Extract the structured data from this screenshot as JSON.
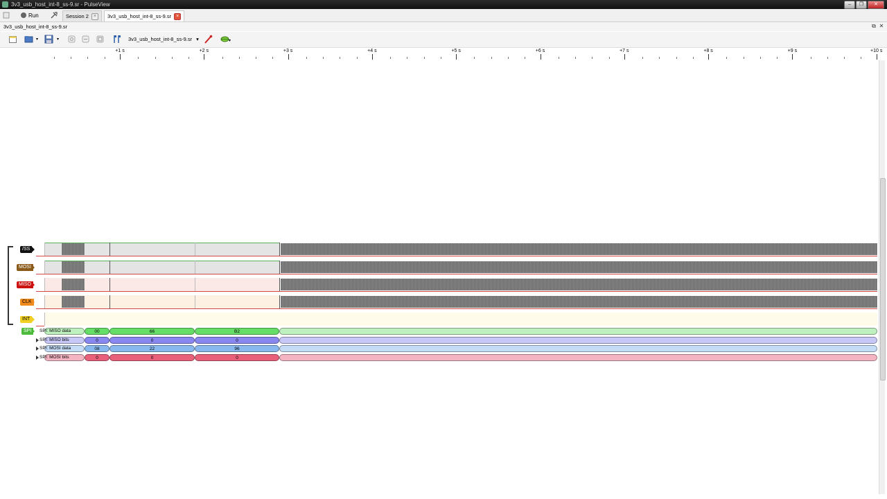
{
  "window": {
    "title": "3v3_usb_host_int-8_ss-9.sr - PulseView",
    "buttons": [
      "–",
      "❐",
      "✕"
    ]
  },
  "tabs": {
    "run_label": "Run",
    "items": [
      {
        "label": "Session 2",
        "close": "×"
      },
      {
        "label": "3v3_usb_host_int-8_ss-9.sr",
        "close": "×"
      }
    ]
  },
  "document": {
    "name": "3v3_usb_host_int-8_ss-9.sr",
    "float_icon": "⧉",
    "close_icon": "✕"
  },
  "toolbar": {
    "device": "3v3_usb_host_int-8_ss-9.sr",
    "device_dropdown": "▾",
    "icons": [
      "new-session-icon",
      "open-icon",
      "save-icon",
      "connect-icon",
      "disconnect-icon",
      "trigger-icon",
      "markers-icon",
      "probe-icon",
      "decoder-icon"
    ]
  },
  "ruler": {
    "labels": [
      "+1 s",
      "+2 s",
      "+3 s",
      "+4 s",
      "+5 s",
      "+6 s",
      "+7 s",
      "+8 s",
      "+9 s",
      "+10 s"
    ]
  },
  "channels": [
    {
      "name": "/SS",
      "color": "#111111",
      "text_color": "#ffffff",
      "line": "#d04545",
      "shade": "#e4e4e4"
    },
    {
      "name": "MOSI",
      "color": "#8a5a1a",
      "text_color": "#ffffff",
      "line": "#d04545",
      "shade": "#e4e4e4"
    },
    {
      "name": "MISO",
      "color": "#cc1111",
      "text_color": "#ffffff",
      "line": "#d04545",
      "shade": "#fbe9e7"
    },
    {
      "name": "CLK",
      "color": "#f08a1c",
      "text_color": "#000000",
      "line": "#d04545",
      "shade": "#fdf1e4"
    },
    {
      "name": "INT",
      "color": "#f0d024",
      "text_color": "#000000",
      "line": "#d04545",
      "shade": "#fffbea"
    }
  ],
  "decoder": {
    "name": "SPI",
    "rows": [
      {
        "label": "SPI: MISO data",
        "color": "#66dd66",
        "light": "#bff0bf",
        "values": [
          "00",
          "66",
          "B2"
        ]
      },
      {
        "label": "SPI: MISO bits",
        "color": "#8888f0",
        "light": "#c8c8f8",
        "values": [
          "0",
          "0",
          "0"
        ]
      },
      {
        "label": "SPI: MOSI data",
        "color": "#88b8ee",
        "light": "#c4dcf6",
        "values": [
          "08",
          "22",
          "96"
        ]
      },
      {
        "label": "SPI: MOSI bits",
        "color": "#e8607a",
        "light": "#f4b4c2",
        "values": [
          "0",
          "0",
          "0"
        ]
      }
    ]
  }
}
